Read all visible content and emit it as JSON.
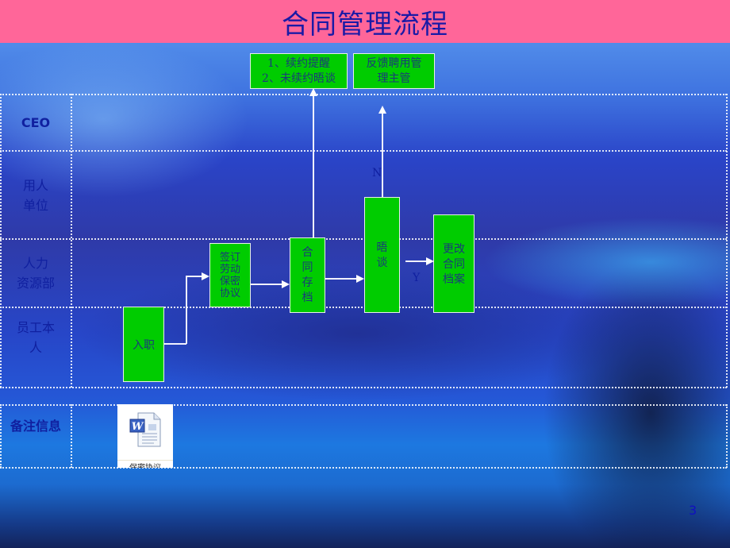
{
  "title": "合同管理流程",
  "lanes": [
    {
      "label": "CEO"
    },
    {
      "label": "用人\n单位"
    },
    {
      "label": "人力\n资源部"
    },
    {
      "label": "员工本\n人"
    }
  ],
  "notes_lane": {
    "label": "备注信息"
  },
  "top_boxes": [
    {
      "line1": "1、续约提醒",
      "line2": "2、未续约晤谈"
    },
    {
      "line1": "反馈聘用管",
      "line2": "理主管"
    }
  ],
  "steps": {
    "onboard": {
      "text": "入职"
    },
    "sign": {
      "lines": [
        "签订",
        "劳动",
        "保密",
        "协议"
      ]
    },
    "archive": {
      "lines": [
        "合",
        "同",
        "存",
        "档"
      ]
    },
    "interview": {
      "lines": [
        "晤",
        "谈"
      ]
    },
    "update": {
      "lines": [
        "更改",
        "合同",
        "档案"
      ]
    }
  },
  "branch_labels": {
    "no": "N",
    "yes": "Y"
  },
  "attachment": {
    "icon": "word-document-icon",
    "caption": "保密协议"
  },
  "colors": {
    "title_bg": "#ff6699",
    "title_text": "#1a1aa6",
    "box_fill": "#00cc00",
    "lane_text": "#1020a0"
  },
  "page_number": "3"
}
